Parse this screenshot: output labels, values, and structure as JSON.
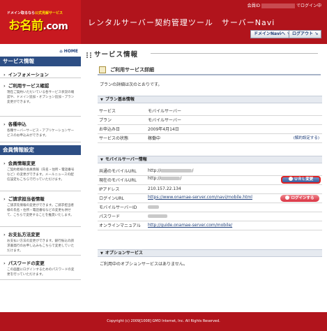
{
  "header": {
    "logo_tagline_pre": "ドメイン取るなら",
    "logo_tagline_hl": "公式見解サービス",
    "logo_main": "お名前",
    "logo_dot": ".com",
    "app_title": "レンタルサーバー契約管理ツール　サーバーNavi",
    "user_id_label": "会員ID",
    "user_id_suffix": "でログイン中",
    "domain_navi_button": "ドメインNaviへ",
    "logout_button": "ログアウト"
  },
  "sidebar": {
    "home_label": "HOME",
    "sections": [
      {
        "title": "サービス情報",
        "items": [
          {
            "label": "インフォメーション",
            "desc": ""
          },
          {
            "label": "ご利用サービス確認",
            "desc": "現在ご契約いただいている各サービス状況の確認や、ドメイン追加・オプション追加・プラン変更ができます。"
          },
          {
            "label": "各種申込",
            "desc": "各種サーバーサービス・アプリケーションサービスのお申込みができます。"
          }
        ]
      },
      {
        "title": "会員情報設定",
        "items": [
          {
            "label": "会員情報変更",
            "desc": "ご契約者様の会員情報（氏名・住所・電話番号など）の変更ができます。メールニュースの配信設定もこちらで行っていただけます。"
          },
          {
            "label": "ご請求担当者情報",
            "desc": "ご請求先情報の変更ができます。ご請求担当者様の氏名・住所・電話番号などの変更も併せて、こちらで変更することを推奨いたします。"
          },
          {
            "label": "お支払方法変更",
            "desc": "お支払い方法の変更ができます。銀行振込の請求書発行のお申し込みもこちらで変更していただけます。"
          },
          {
            "label": "パスワードの変更",
            "desc": "この画面にログインするためのパスワードの変更を行っていただけます。"
          }
        ]
      }
    ]
  },
  "main": {
    "page_title": "サービス情報",
    "panel_title": "ご利用サービス詳細",
    "intro": "プランの詳細は次のとおりです。",
    "plan_section": {
      "title": "プラン基本情報",
      "rows": [
        {
          "key": "サービス",
          "value": "モバイルサーバー"
        },
        {
          "key": "プラン",
          "value": "モバイルサーバー"
        },
        {
          "key": "お申込み日",
          "value": "2009年4月14日"
        },
        {
          "key": "サービスの状態",
          "value": "稼働中",
          "action": "(解約設定する)"
        }
      ]
    },
    "mobile_section": {
      "title": "モバイルサーバー情報",
      "rows": [
        {
          "key": "共通のモバイルURL",
          "prefix": "http://",
          "suffix": "/"
        },
        {
          "key": "現在のモバイルURL",
          "prefix": "http://",
          "suffix": "/",
          "button": "ＵＲＬ変更"
        },
        {
          "key": "IPアドレス",
          "value": "210.157.22.134"
        },
        {
          "key": "ログインURL",
          "value": "https://www.onamae-server.com/navi/mobile.html",
          "button": "ログインする"
        },
        {
          "key": "モバイルサーバーID",
          "value": ""
        },
        {
          "key": "パスワード",
          "value": ""
        },
        {
          "key": "オンラインマニュアル",
          "value": "http://guide.onamae-server.com/mobile/"
        }
      ]
    },
    "option_section": {
      "title": "オプションサービス",
      "text": "ご利用中のオプションサービスはありません。"
    }
  },
  "footer": {
    "copyright": "Copyright (c) 2009[1008] GMO Internet, Inc. All Rights Reserved."
  }
}
